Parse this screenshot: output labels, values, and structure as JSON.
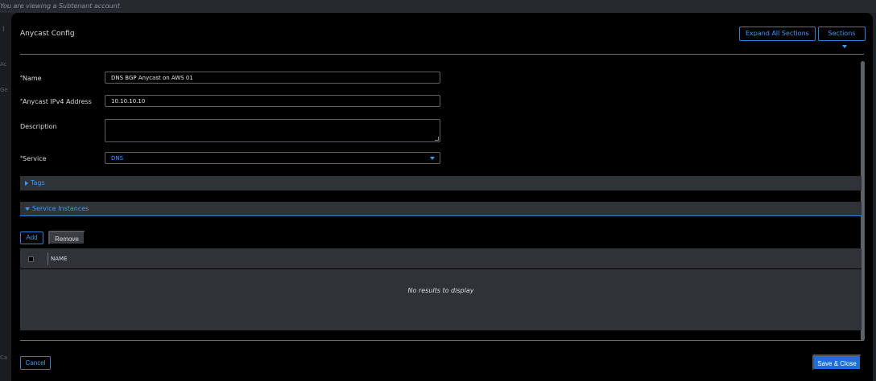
{
  "banner": {
    "text": "You are viewing a Subtenant account"
  },
  "background": {
    "glyph_1": "I",
    "glyph_2": "Ac",
    "glyph_3": "Ge",
    "glyph_4": "Ca"
  },
  "modal": {
    "title": "Anycast Config",
    "expand_all_label": "Expand All Sections",
    "sections_label": "Sections"
  },
  "form": {
    "name": {
      "label": "Name",
      "value": "DNS BGP Anycast on AWS 01"
    },
    "ipv4": {
      "label": "Anycast IPv4 Address",
      "value": "10.10.10.10"
    },
    "description": {
      "label": "Description",
      "value": ""
    },
    "service": {
      "label": "Service",
      "value": "DNS"
    }
  },
  "sections": {
    "tags": {
      "label": "Tags",
      "state": "collapsed"
    },
    "service_instances": {
      "label": "Service Instances",
      "state": "expanded"
    }
  },
  "instances": {
    "add_label": "Add",
    "remove_label": "Remove",
    "columns": [
      "NAME"
    ],
    "empty_message": "No results to display"
  },
  "footer": {
    "cancel_label": "Cancel",
    "save_label": "Save & Close"
  },
  "colors": {
    "accent": "#3b9bff",
    "primary_button": "#1e6fd9",
    "panel": "#2f3338",
    "modal_bg": "#000000"
  }
}
